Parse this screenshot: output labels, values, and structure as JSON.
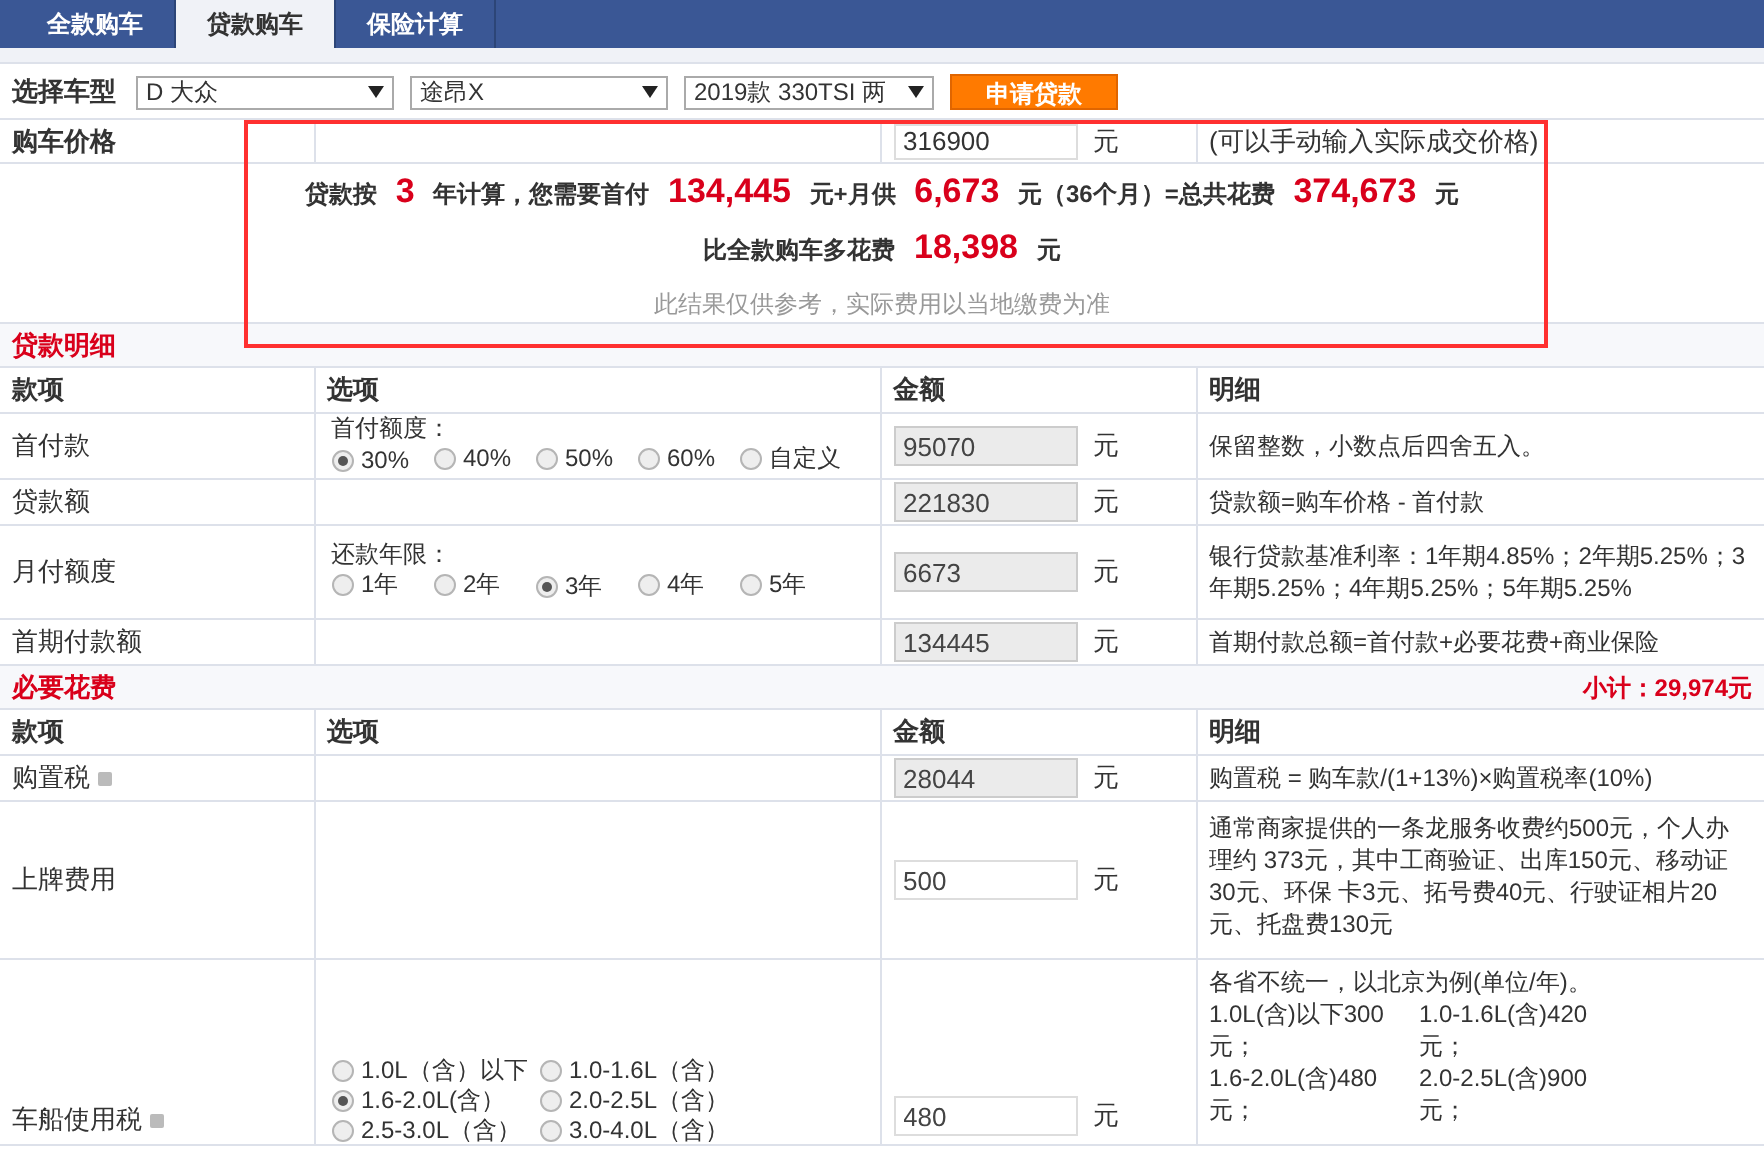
{
  "tabs": [
    {
      "label": "全款购车",
      "selected": false
    },
    {
      "label": "贷款购车",
      "selected": true
    },
    {
      "label": "保险计算",
      "selected": false
    }
  ],
  "car_select": {
    "label": "选择车型",
    "selects": [
      "D 大众",
      "途昂X",
      "2019款 330TSI 两"
    ],
    "apply_button": "申请贷款"
  },
  "price_row": {
    "label": "购车价格",
    "value": "316900",
    "unit": "元",
    "note": "(可以手动输入实际成交价格)"
  },
  "summary": {
    "line1": "贷款按 **3** 年计算，您需要首付 **134,445** 元+月供 **6,673** 元（36个月）=总共花费 **374,673** 元",
    "line2": "比全款购车多花费 **18,398** 元",
    "disclaimer": "此结果仅供参考，实际费用以当地缴费为准"
  },
  "loan_section": {
    "title": "贷款明细",
    "columns": [
      "款项",
      "选项",
      "金额",
      "明细"
    ],
    "rows": [
      {
        "item": "首付款",
        "option_label": "首付额度：",
        "options": [
          {
            "label": "30%",
            "selected": true
          },
          {
            "label": "40%",
            "selected": false
          },
          {
            "label": "50%",
            "selected": false
          },
          {
            "label": "60%",
            "selected": false
          },
          {
            "label": "自定义",
            "selected": false
          }
        ],
        "amount": "95070",
        "readonly": true,
        "unit": "元",
        "detail": "保留整数，小数点后四舍五入。"
      },
      {
        "item": "贷款额",
        "amount": "221830",
        "readonly": true,
        "unit": "元",
        "detail": "贷款额=购车价格 - 首付款"
      },
      {
        "item": "月付额度",
        "option_label": "还款年限：",
        "options": [
          {
            "label": "1年",
            "selected": false
          },
          {
            "label": "2年",
            "selected": false
          },
          {
            "label": "3年",
            "selected": true
          },
          {
            "label": "4年",
            "selected": false
          },
          {
            "label": "5年",
            "selected": false
          }
        ],
        "amount": "6673",
        "readonly": true,
        "unit": "元",
        "detail": "银行贷款基准利率：1年期4.85%；2年期5.25%；3年期5.25%；4年期5.25%；5年期5.25%"
      },
      {
        "item": "首期付款额",
        "amount": "134445",
        "readonly": true,
        "unit": "元",
        "detail": "首期付款总额=首付款+必要花费+商业保险"
      }
    ]
  },
  "fees_section": {
    "title": "必要花费",
    "subtotal": "小计：29,974元",
    "columns": [
      "款项",
      "选项",
      "金额",
      "明细"
    ],
    "rows": [
      {
        "item": "购置税",
        "info": true,
        "amount": "28044",
        "readonly": true,
        "unit": "元",
        "detail": "购置税 = 购车款/(1+13%)×购置税率(10%)"
      },
      {
        "item": "上牌费用",
        "info": false,
        "amount": "500",
        "readonly": false,
        "unit": "元",
        "detail": "通常商家提供的一条龙服务收费约500元，个人办理约 373元，其中工商验证、出库150元、移动证30元、环保 卡3元、拓号费40元、行驶证相片20元、托盘费130元"
      },
      {
        "item": "车船使用税",
        "info": true,
        "options": [
          {
            "label": "1.0L（含）以下",
            "selected": false
          },
          {
            "label": "1.0-1.6L（含）",
            "selected": false
          },
          {
            "label": "1.6-2.0L(含）",
            "selected": true
          },
          {
            "label": "2.0-2.5L（含）",
            "selected": false
          },
          {
            "label": "2.5-3.0L（含）",
            "selected": false
          },
          {
            "label": "3.0-4.0L（含）",
            "selected": false
          }
        ],
        "amount": "480",
        "readonly": false,
        "unit": "元",
        "detail": "各省不统一，以北京为例(单位/年)。",
        "detail_grid": [
          "1.0L(含)以下300元；",
          "1.0-1.6L(含)420元；",
          "1.6-2.0L(含)480元；",
          "2.0-2.5L(含)900元；"
        ]
      }
    ]
  }
}
